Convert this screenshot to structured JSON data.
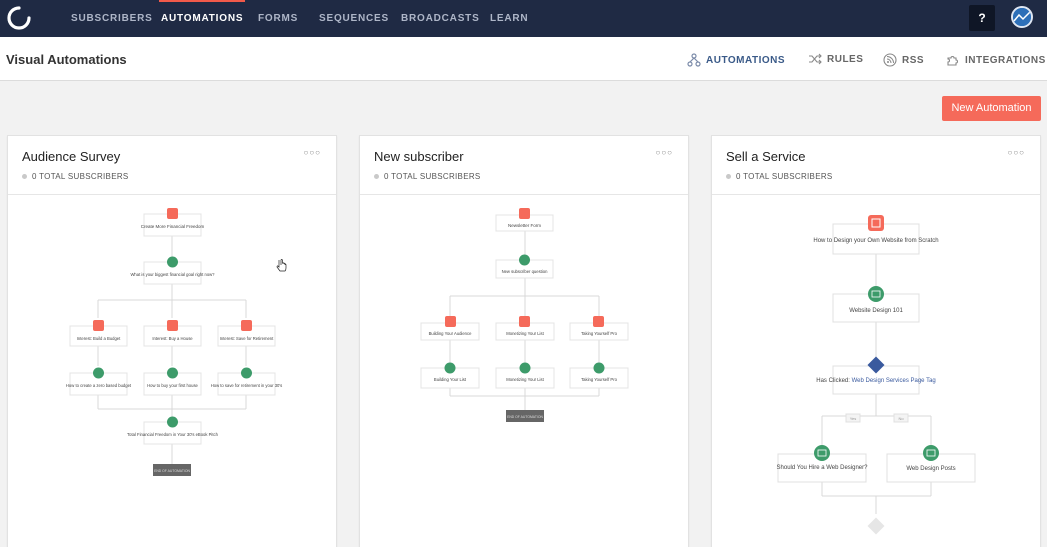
{
  "nav": {
    "items": [
      "SUBSCRIBERS",
      "AUTOMATIONS",
      "FORMS",
      "SEQUENCES",
      "BROADCASTS",
      "LEARN"
    ],
    "active": "AUTOMATIONS",
    "help_label": "?"
  },
  "header": {
    "title": "Visual Automations",
    "links": [
      "AUTOMATIONS",
      "RULES",
      "RSS",
      "INTEGRATIONS"
    ]
  },
  "actions": {
    "new_automation": "New Automation"
  },
  "colors": {
    "nav_bg": "#1f2a44",
    "accent": "#f56a5a",
    "email_green": "#3d9b6a",
    "tag_blue": "#3a5a9e"
  },
  "cards": [
    {
      "title": "Audience Survey",
      "subscribers": "0 TOTAL SUBSCRIBERS",
      "menu": "○○○",
      "nodes": {
        "form": "Create More Financial Freedom",
        "q1": "What is your biggest financial goal right now?",
        "b1": "Interest: Build a Budget",
        "b2": "Interest: Buy a House",
        "b3": "Interest: Save for Retirement",
        "e1": "How to create a zero based budget",
        "e2": "How to buy your first house",
        "e3": "How to save for retirement in your 30's",
        "final": "Total Financial Freedom in Your 30's eBook Pitch",
        "end": "END OF AUTOMATION"
      }
    },
    {
      "title": "New subscriber",
      "subscribers": "0 TOTAL SUBSCRIBERS",
      "menu": "○○○",
      "nodes": {
        "form": "Newsletter Form",
        "q1": "New subscriber question",
        "b1": "Building Your Audience",
        "b2": "Monetizing Your List",
        "b3": "Taking Yourself Pro",
        "e1": "Building Your List",
        "e2": "Monetizing Your List",
        "e3": "Taking Yourself Pro",
        "end": "END OF AUTOMATION"
      }
    },
    {
      "title": "Sell a Service",
      "subscribers": "0 TOTAL SUBSCRIBERS",
      "menu": "○○○",
      "nodes": {
        "form": "How to Design your Own Website from Scratch",
        "e1": "Website Design 101",
        "tag_prefix": "Has Clicked:",
        "tag": "Web Design Services Page Tag",
        "yes": "Yes",
        "no": "No",
        "e2": "Should You Hire a Web Designer?",
        "e3": "Web Design Posts"
      }
    }
  ]
}
